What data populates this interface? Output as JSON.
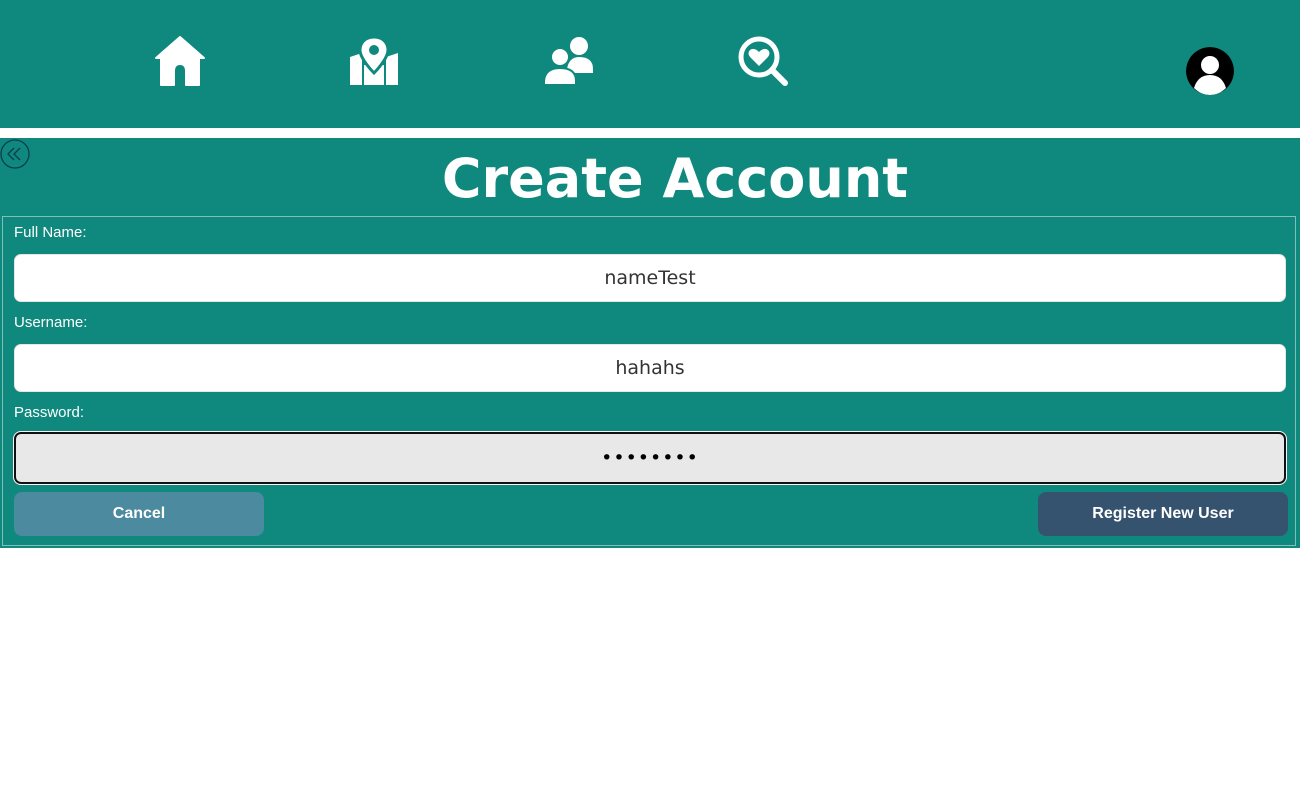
{
  "nav": {
    "items": [
      {
        "icon": "home-icon",
        "name": "nav-home"
      },
      {
        "icon": "map-pin-icon",
        "name": "nav-map"
      },
      {
        "icon": "users-icon",
        "name": "nav-people"
      },
      {
        "icon": "search-heart-icon",
        "name": "nav-search"
      }
    ],
    "profile_icon": "user-avatar-icon"
  },
  "colors": {
    "primary": "#0f897e",
    "cancel": "#4b8a9f",
    "register": "#35536f"
  },
  "page": {
    "back_icon": "double-chevron-left-icon",
    "title": "Create Account"
  },
  "form": {
    "fullname": {
      "label": "Full Name:",
      "value": "nameTest"
    },
    "username": {
      "label": "Username:",
      "value": "hahahs"
    },
    "password": {
      "label": "Password:",
      "value": "aaaaaaaa"
    },
    "cancel_label": "Cancel",
    "register_label": "Register New User"
  }
}
